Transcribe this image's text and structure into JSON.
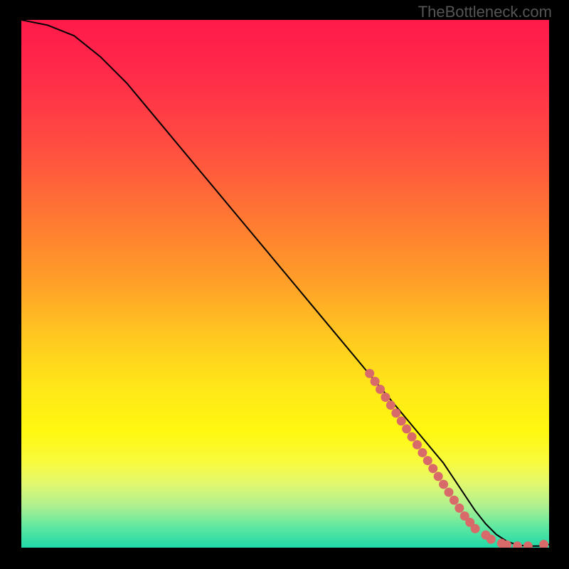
{
  "watermark": "TheBottleneck.com",
  "chart_data": {
    "type": "line",
    "title": "",
    "xlabel": "",
    "ylabel": "",
    "xlim": [
      0,
      100
    ],
    "ylim": [
      0,
      100
    ],
    "curve": {
      "name": "main-curve",
      "x": [
        0,
        5,
        10,
        15,
        20,
        25,
        30,
        35,
        40,
        45,
        50,
        55,
        60,
        65,
        70,
        75,
        80,
        82,
        84,
        86,
        88,
        90,
        92,
        94,
        96,
        98,
        100
      ],
      "y": [
        100,
        99,
        97,
        93,
        88,
        82,
        76,
        70,
        64,
        58,
        52,
        46,
        40,
        34,
        28,
        22,
        16,
        13,
        10,
        7,
        4.5,
        2.5,
        1.2,
        0.5,
        0.3,
        0.3,
        0.6
      ]
    },
    "markers": {
      "name": "highlight-markers",
      "color": "#d96a6a",
      "x": [
        66,
        67,
        68,
        69,
        70,
        71,
        72,
        73,
        74,
        75,
        76,
        77,
        78,
        79,
        80,
        81,
        82,
        83,
        84,
        85,
        86,
        88,
        89,
        91,
        92,
        94,
        96,
        99
      ],
      "y": [
        33,
        31.5,
        30,
        28.5,
        27,
        25.5,
        24,
        22.5,
        21,
        19.5,
        18,
        16.5,
        15,
        13.5,
        12,
        10.5,
        9,
        7.5,
        6,
        4.8,
        3.6,
        2.4,
        1.6,
        0.8,
        0.5,
        0.3,
        0.3,
        0.6
      ]
    }
  }
}
